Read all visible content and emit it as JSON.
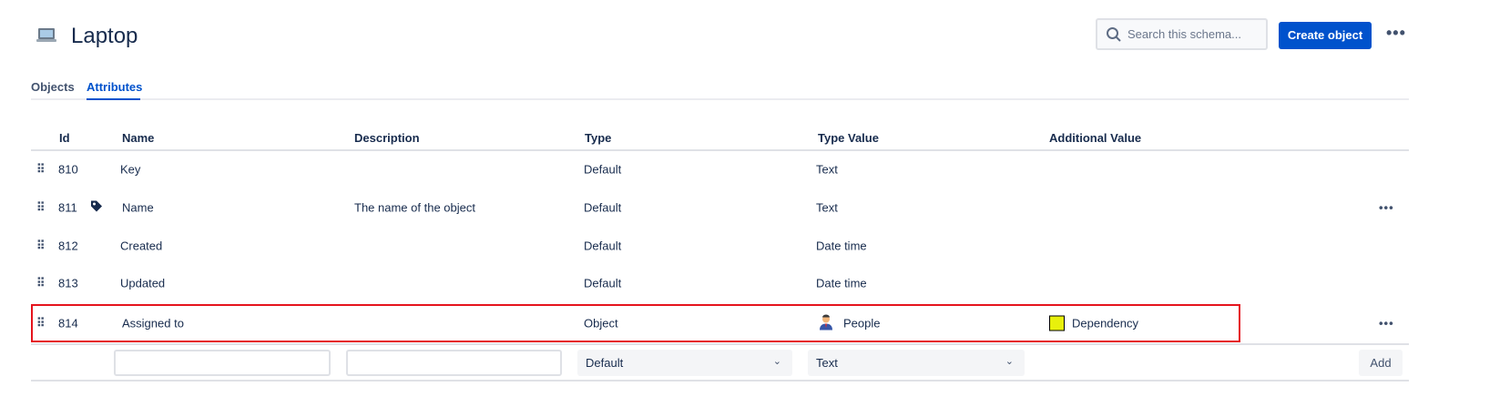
{
  "header": {
    "title": "Laptop",
    "search_placeholder": "Search this schema...",
    "create_label": "Create object",
    "more": "•••"
  },
  "tabs": [
    {
      "label": "Objects"
    },
    {
      "label": "Attributes"
    }
  ],
  "columns": [
    "Id",
    "Name",
    "Description",
    "Type",
    "Type Value",
    "Additional Value"
  ],
  "rows": [
    {
      "id": "810",
      "name": "Key",
      "description": "",
      "type": "Default",
      "type_value": "Text",
      "additional": ""
    },
    {
      "id": "811",
      "name": "Name",
      "description": "The name of the object",
      "type": "Default",
      "type_value": "Text",
      "additional": "",
      "label_icon": "tag-icon"
    },
    {
      "id": "812",
      "name": "Created",
      "description": "",
      "type": "Default",
      "type_value": "Date time",
      "additional": ""
    },
    {
      "id": "813",
      "name": "Updated",
      "description": "",
      "type": "Default",
      "type_value": "Date time",
      "additional": ""
    },
    {
      "id": "814",
      "name": "Assigned to",
      "description": "",
      "type": "Object",
      "type_value": "People",
      "additional": "Dependency",
      "additional_color": "#e8f00c"
    }
  ],
  "new_row": {
    "type_select": "Default",
    "type_value_select": "Text",
    "add_label": "Add"
  },
  "colors": {
    "accent": "#0052cc",
    "highlight": "#e5141d"
  }
}
